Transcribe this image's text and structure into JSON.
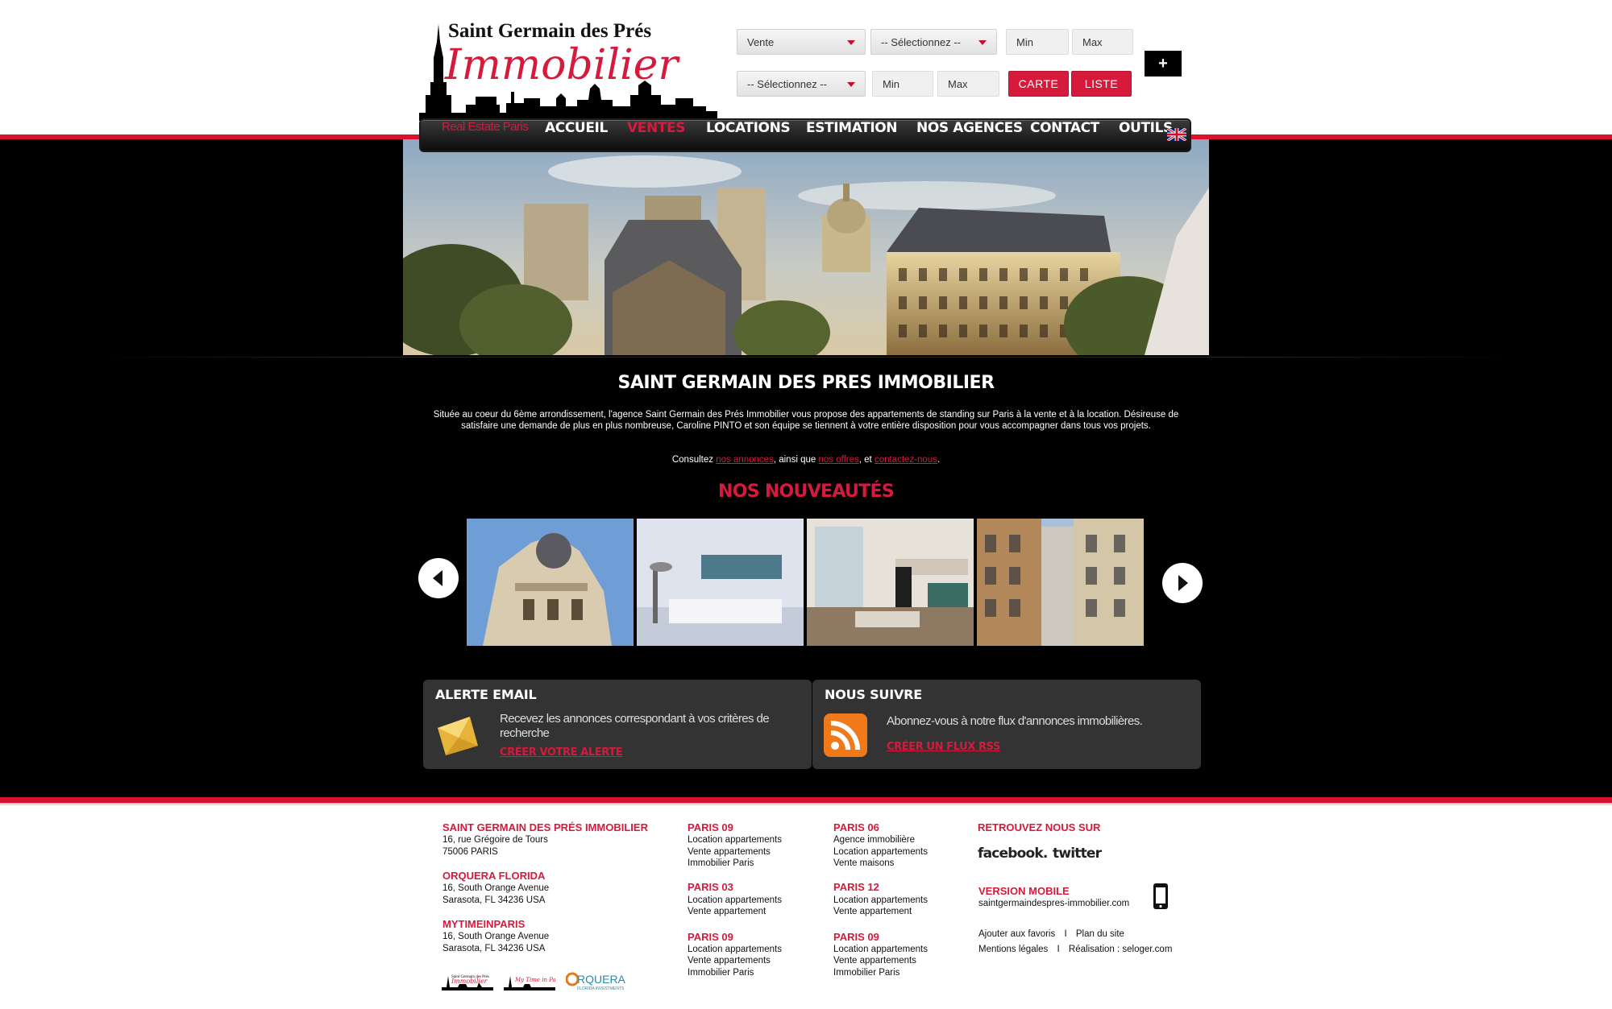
{
  "logo": {
    "line1": "Saint Germain des Prés",
    "line2": "Immobilier"
  },
  "search": {
    "transaction": "Vente",
    "select1": "-- Sélectionnez --",
    "select2": "-- Sélectionnez --",
    "min1": "Min",
    "max1": "Max",
    "min2": "Min",
    "max2": "Max",
    "carte": "CARTE",
    "liste": "LISTE",
    "plus": "+"
  },
  "nav": {
    "tagline": "Real Estate Paris",
    "items": [
      "ACCUEIL",
      "VENTES",
      "LOCATIONS",
      "ESTIMATION",
      "NOS AGENCES",
      "CONTACT",
      "OUTILS"
    ],
    "active": "VENTES",
    "flag_icon": "uk-flag-icon"
  },
  "intro": {
    "title": "SAINT GERMAIN DES PRES IMMOBILIER",
    "text": "Située au coeur du 6ème arrondissement, l'agence Saint Germain des Prés Immobilier vous propose des appartements de standing sur Paris  à la vente et à la location. Désireuse de satisfaire une demande de plus en plus nombreuse, Caroline PINTO et son équipe  se tiennent à votre entière disposition pour vous accompagner dans tous vos projets.",
    "consult_prefix": "Consultez ",
    "link_annonces": "nos annonces",
    "consult_mid1": ", ainsi que ",
    "link_offres": "nos offres",
    "consult_mid2": ", et ",
    "link_contact": "contactez-nous",
    "consult_suffix": "."
  },
  "nouveautes": {
    "title": "NOS NOUVEAUTÉS"
  },
  "alert_box": {
    "title": "ALERTE EMAIL",
    "text": "Recevez les annonces correspondant à vos critères de recherche",
    "link": "CRÉER VOTRE ALERTE"
  },
  "follow_box": {
    "title": "NOUS SUIVRE",
    "text": "Abonnez-vous à notre flux d'annonces immobilières.",
    "link": "CRÉER UN FLUX RSS"
  },
  "footer": {
    "col1": [
      {
        "title": "SAINT GERMAIN DES PRÉS IMMOBILIER",
        "lines": [
          "16, rue Grégoire de Tours",
          "75006 PARIS"
        ]
      },
      {
        "title": "ORQUERA FLORIDA",
        "lines": [
          "16, South Orange Avenue",
          "Sarasota, FL 34236 USA"
        ]
      },
      {
        "title": "MYTIMEINPARIS",
        "lines": [
          "16, South Orange Avenue",
          "Sarasota, FL 34236 USA"
        ]
      }
    ],
    "partner_logos": [
      "Saint Germain des Prés Immobilier",
      "My Time in Paris",
      "ORQUERA",
      "FLORIDA INVESTMENTS"
    ],
    "col2": [
      {
        "title": "PARIS 09",
        "lines": [
          "Location appartements",
          "Vente appartements",
          "Immobilier Paris"
        ]
      },
      {
        "title": "PARIS 03",
        "lines": [
          "Location appartements",
          "Vente appartement"
        ]
      },
      {
        "title": "PARIS 09",
        "lines": [
          "Location appartements",
          "Vente appartements",
          "Immobilier Paris"
        ]
      }
    ],
    "col3": [
      {
        "title": "PARIS 06",
        "lines": [
          "Agence immobilière",
          "Location appartements",
          "Vente maisons"
        ]
      },
      {
        "title": "PARIS 12",
        "lines": [
          "Location appartements",
          "Vente appartement"
        ]
      },
      {
        "title": "PARIS 09",
        "lines": [
          "Location appartements",
          "Vente appartements",
          "Immobilier Paris"
        ]
      }
    ],
    "social_title": "RETROUVEZ NOUS SUR",
    "facebook": "facebook.",
    "twitter": "twitter",
    "mobile_title": "VERSION MOBILE",
    "mobile_url": "saintgermaindespres-immobilier.com",
    "links1": [
      "Ajouter aux favoris",
      "Plan du site"
    ],
    "links2": [
      "Mentions légales",
      "Réalisation : seloger.com"
    ],
    "separator": "I"
  },
  "colors": {
    "accent": "#d61a3c",
    "background": "#000000",
    "box": "#333333"
  }
}
